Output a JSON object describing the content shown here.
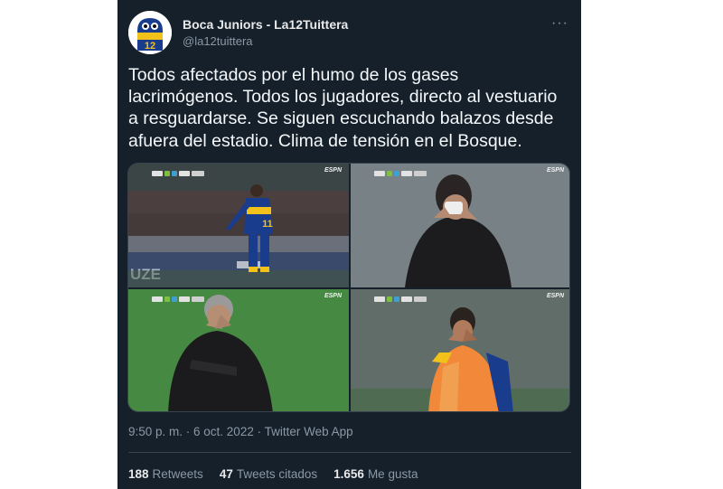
{
  "user": {
    "display_name": "Boca Juniors - La12Tuittera",
    "handle": "@la12tuittera",
    "avatar_icon": "cartoon-ghost-avatar",
    "avatar_number": "12",
    "more_icon": "···"
  },
  "tweet": {
    "text": "Todos afectados por el humo de los gases lacrimógenos. Todos los jugadores, directo al vestuario a resguardarse. Se siguen escuchando balazos desde afuera del estadio. Clima de tensión en el Bosque.",
    "timestamp": "9:50 p. m. · 6 oct. 2022 · ",
    "source": "Twitter Web App"
  },
  "media": {
    "broadcaster": "ESPN",
    "player_number": "11",
    "panels": [
      {
        "icon": "player-walking-image"
      },
      {
        "icon": "coach-covering-face-image"
      },
      {
        "icon": "coach-hands-on-face-image"
      },
      {
        "icon": "substitute-rubbing-eyes-image"
      }
    ]
  },
  "stats": {
    "retweets_count": "188",
    "retweets_label": "Retweets",
    "quotes_count": "47",
    "quotes_label": "Tweets citados",
    "likes_count": "1.656",
    "likes_label": "Me gusta"
  },
  "colors": {
    "background": "#15202b",
    "text": "#f5f8fa",
    "muted": "#8b98a5",
    "boca_blue": "#1a3c8c",
    "boca_yellow": "#f2c21a"
  }
}
